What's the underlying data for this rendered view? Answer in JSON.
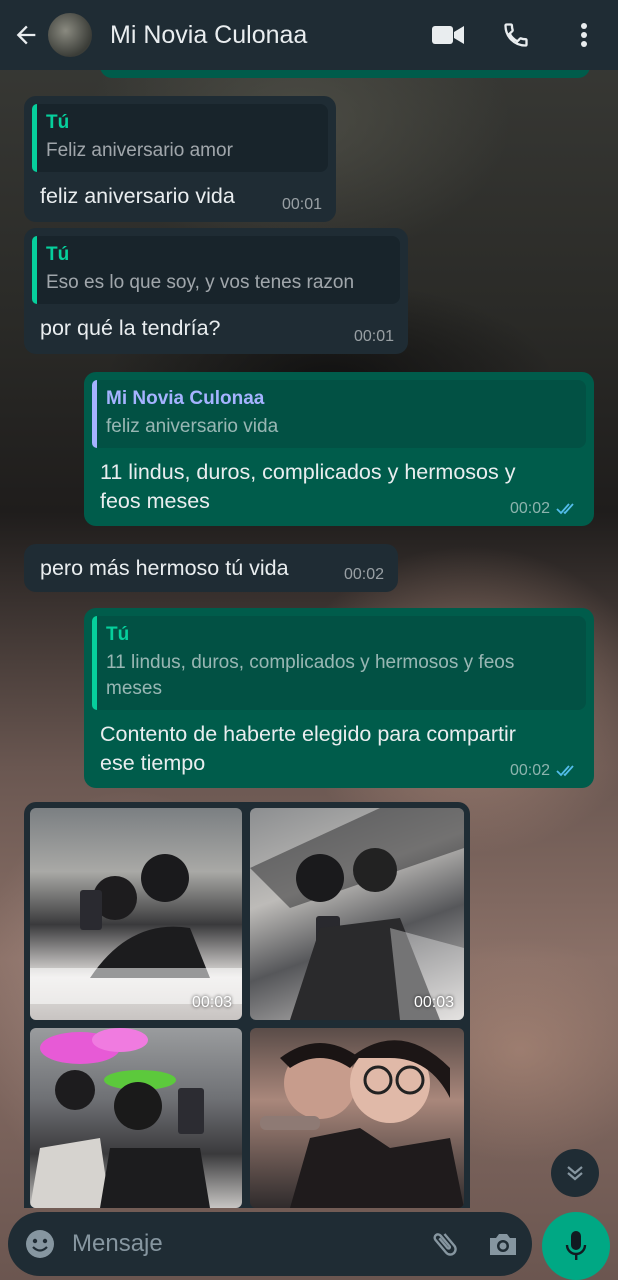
{
  "header": {
    "contact_name": "Mi Novia Culonaa",
    "icons": [
      "back-arrow-icon",
      "video-call-icon",
      "voice-call-icon",
      "more-vert-icon"
    ]
  },
  "messages": [
    {
      "direction": "incoming",
      "quote_author": "Tú",
      "quote_text": "Feliz aniversario amor",
      "text": "feliz aniversario vida",
      "time": "00:01"
    },
    {
      "direction": "incoming",
      "quote_author": "Tú",
      "quote_text": "Eso es lo que soy,  y vos tenes razon",
      "text": "por qué la tendría?",
      "time": "00:01"
    },
    {
      "direction": "outgoing",
      "quote_author": "Mi Novia Culonaa",
      "quote_text": "feliz aniversario vida",
      "text": "11 lindus, duros, complicados y  hermosos y feos meses",
      "time": "00:02",
      "status": "read"
    },
    {
      "direction": "incoming",
      "text": "pero más hermoso tú vida",
      "time": "00:02"
    },
    {
      "direction": "outgoing",
      "quote_author": "Tú",
      "quote_text": "11 lindus, duros, complicados y  hermosos y feos meses",
      "text": "Contento de haberte elegido para compartir ese tiempo",
      "time": "00:02",
      "status": "read"
    }
  ],
  "media": [
    {
      "time": "00:03"
    },
    {
      "time": "00:03"
    },
    {
      "time": ""
    },
    {
      "time": ""
    }
  ],
  "composer": {
    "placeholder": "Mensaje"
  },
  "colors": {
    "header_bg": "#1f2c34",
    "incoming_bubble": "#1f2c34",
    "outgoing_bubble": "#005c4b",
    "accent": "#00a884",
    "read_ticks": "#53bdeb"
  }
}
